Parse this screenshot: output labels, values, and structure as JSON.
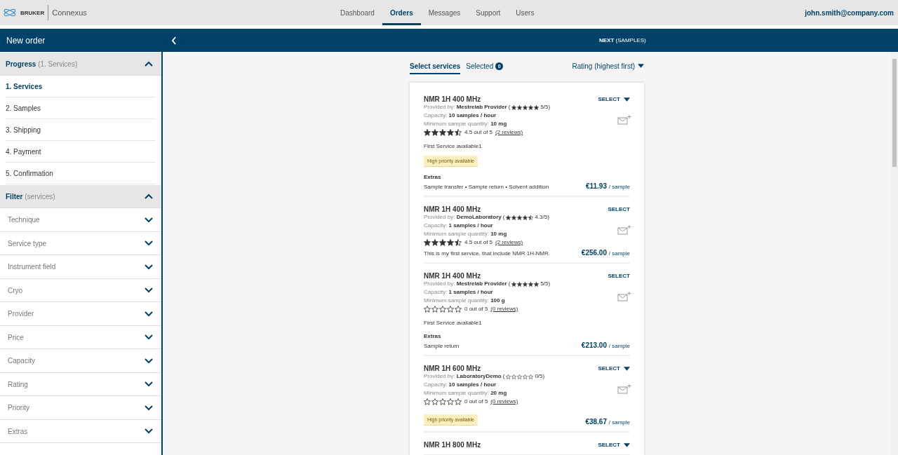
{
  "header": {
    "brand": "BRUKER",
    "product": "Connexus",
    "nav": [
      {
        "label": "Dashboard",
        "selected": false
      },
      {
        "label": "Orders",
        "selected": true
      },
      {
        "label": "Messages",
        "selected": false
      },
      {
        "label": "Support",
        "selected": false
      },
      {
        "label": "Users",
        "selected": false
      }
    ],
    "user": "john.smith@company.com"
  },
  "action_bar": {
    "title": "New order",
    "next": "**NEXT** (SAMPLES)"
  },
  "sidebar": {
    "progress": {
      "title": "Progress",
      "hint": "(1. Services)",
      "expanded": true,
      "steps": [
        {
          "label": "1. Services",
          "selected": true
        },
        {
          "label": "2. Samples",
          "selected": false
        },
        {
          "label": "3. Shipping",
          "selected": false
        },
        {
          "label": "4. Payment",
          "selected": false
        },
        {
          "label": "5. Confirmation",
          "selected": false
        }
      ]
    },
    "filter": {
      "title": "Filter",
      "hint": "(services)",
      "expanded": true,
      "items": [
        {
          "label": "Technique",
          "expanded": false
        },
        {
          "label": "Service type",
          "expanded": false
        },
        {
          "label": "Instrument field",
          "expanded": false
        },
        {
          "label": "Cryo",
          "expanded": false
        },
        {
          "label": "Provider",
          "expanded": false
        },
        {
          "label": "Price",
          "expanded": false
        },
        {
          "label": "Capacity",
          "expanded": false
        },
        {
          "label": "Rating",
          "expanded": false
        },
        {
          "label": "Priority",
          "expanded": false
        },
        {
          "label": "Extras",
          "expanded": false
        }
      ]
    }
  },
  "tabs": [
    {
      "label": "Select services",
      "selected": true
    },
    {
      "label": "Selected",
      "count": "0",
      "selected": false
    }
  ],
  "sort": "Rating (highest first)",
  "services": [
    {
      "title": "NMR 1H 400 MHz",
      "select": "SELECT",
      "has_menu": true,
      "provided_label": "Provided by:",
      "provider": "Mestrelab Provider",
      "provider_score": {
        "open": "(",
        "stars": 5,
        "rating": "5/5)"
      },
      "capacity_label": "Capacity:",
      "capacity": "10 samples / hour",
      "min_label": "Minimum sample quantity:",
      "min_quantity": "10 mg",
      "stars": 4.5,
      "rating": "4.5 out of 5",
      "reviews": "(2 reviews)",
      "description": "First Service available1",
      "priority": "High priority available",
      "extras_title": "Extras",
      "extras": "Sample transfer • Sample return • Solvent addition",
      "price": "€11.93",
      "unit": "/ sample"
    },
    {
      "title": "NMR 1H 400 MHz",
      "select": "SELECT",
      "has_menu": false,
      "provided_label": "Provided by:",
      "provider": "DemoLaboratory",
      "provider_score": {
        "open": "(",
        "stars": 4.5,
        "rating": "4.3/5)"
      },
      "capacity_label": "Capacity:",
      "capacity": "1 samples / hour",
      "min_label": "Minimum sample quantity:",
      "min_quantity": "10 mg",
      "stars": 4.5,
      "rating": "4.5 out of 5",
      "reviews": "(2 reviews)",
      "description": "This is my first service, that include NMR 1H-NMR.",
      "price": "€256.00",
      "unit": "/ sample"
    },
    {
      "title": "NMR 1H 400 MHz",
      "select": "SELECT",
      "has_menu": false,
      "provided_label": "Provided by:",
      "provider": "Mestrelab Provider",
      "provider_score": {
        "open": "(",
        "stars": 5,
        "rating": "5/5)"
      },
      "capacity_label": "Capacity:",
      "capacity": "1 samples / hour",
      "min_label": "Minimum sample quantity:",
      "min_quantity": "100 g",
      "stars": 0,
      "rating": "0 out of 5",
      "reviews": "(0 reviews)",
      "description": "First Service available1",
      "extras_title": "Extras",
      "extras": "Sample return",
      "price": "€213.00",
      "unit": "/ sample"
    },
    {
      "title": "NMR 1H 600 MHz",
      "select": "SELECT",
      "has_menu": true,
      "provided_label": "Provided by:",
      "provider": "LaboratoryDemo",
      "provider_score": {
        "open": "(",
        "stars": 0,
        "rating": "0/5)"
      },
      "capacity_label": "Capacity:",
      "capacity": "10 samples / hour",
      "min_label": "Minimum sample quantity:",
      "min_quantity": "20 mg",
      "stars": 0,
      "rating": "0 out of 5",
      "reviews": "(0 reviews)",
      "priority": "High priority available",
      "price": "€38.67",
      "unit": "/ sample"
    },
    {
      "title": "NMR 1H 800 MHz",
      "select": "SELECT",
      "has_menu": true
    }
  ]
}
